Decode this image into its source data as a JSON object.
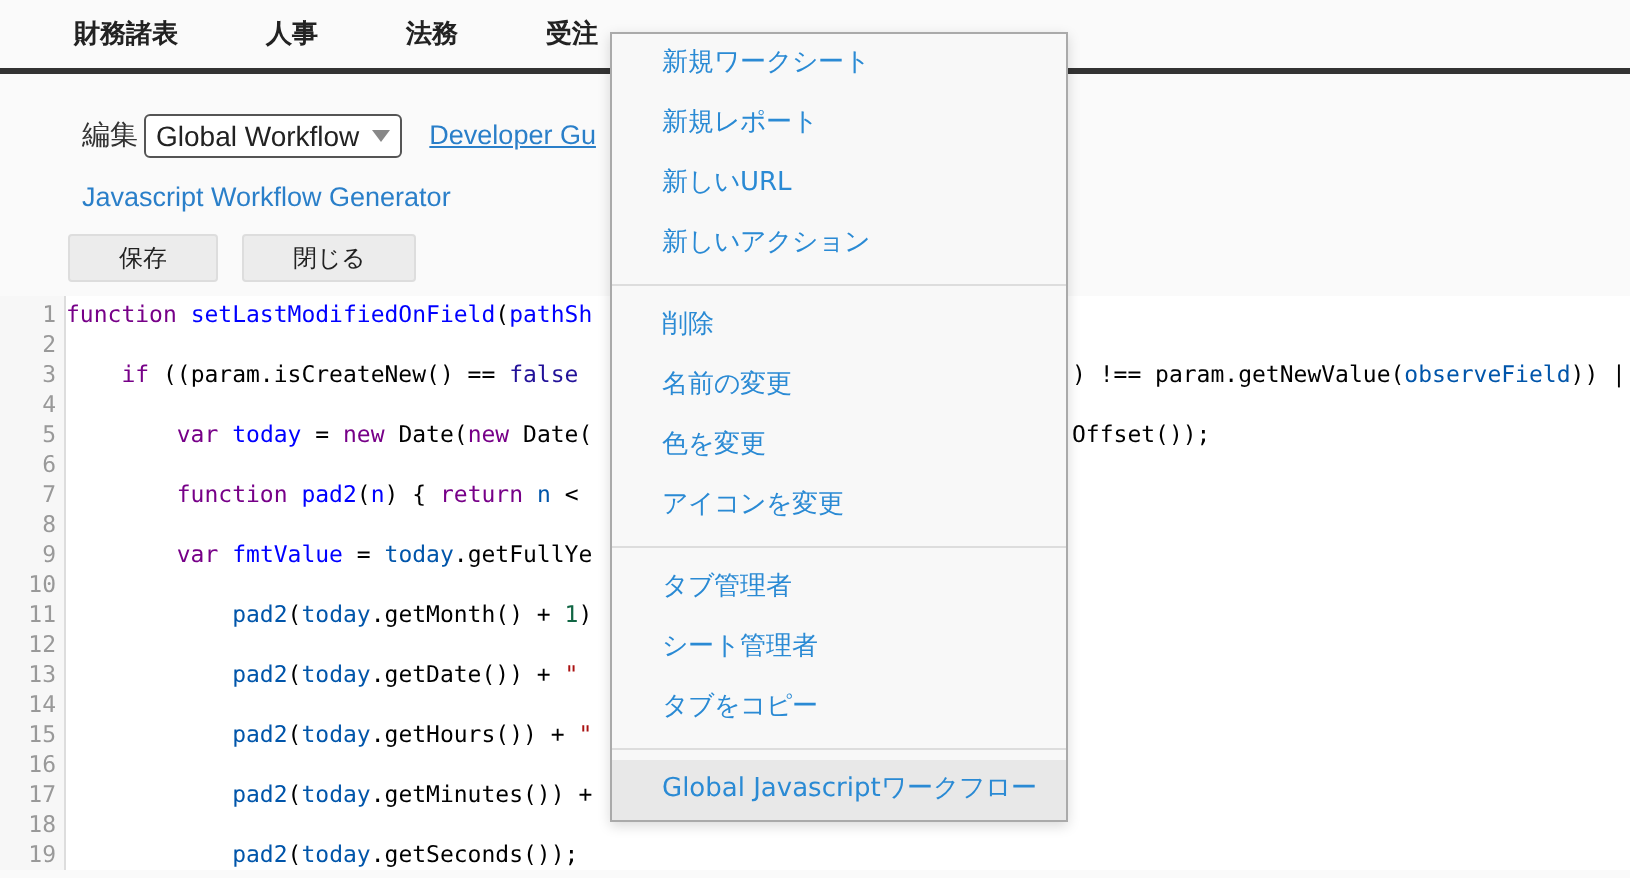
{
  "nav": {
    "tabs": [
      {
        "label": "財務諸表"
      },
      {
        "label": "人事"
      },
      {
        "label": "法務"
      },
      {
        "label": "受注"
      }
    ]
  },
  "editor": {
    "label": "編集",
    "select": {
      "value": "Global Workflow"
    },
    "guide_link": "Developer Gu",
    "generator_link": "Javascript Workflow Generator"
  },
  "buttons": [
    "保存",
    "閉じる"
  ],
  "code": {
    "lines": [
      {
        "number": "1",
        "left": [
          {
            "t": "function",
            "kind": "keyword"
          },
          {
            "t": " setLastModifiedOnField",
            "kind": "def"
          },
          {
            "t": "(",
            "kind": "plain"
          },
          {
            "t": "pathSh",
            "kind": "def"
          }
        ]
      },
      {
        "number": "2"
      },
      {
        "number": "3",
        "left": [
          {
            "t": "    if",
            "kind": "keyword"
          },
          {
            "t": " ((param.isCreateNew() == ",
            "kind": "plain"
          },
          {
            "t": "false",
            "kind": "atom"
          }
        ],
        "right": [
          {
            "t": ") !== param.getNewValue(",
            "kind": "plain"
          },
          {
            "t": "observeField",
            "kind": "variable"
          },
          {
            "t": ")) |",
            "kind": "plain"
          }
        ]
      },
      {
        "number": "4"
      },
      {
        "number": "5",
        "left": [
          {
            "t": "        var",
            "kind": "keyword"
          },
          {
            "t": " today",
            "kind": "def"
          },
          {
            "t": " = ",
            "kind": "plain"
          },
          {
            "t": "new",
            "kind": "keyword"
          },
          {
            "t": " Date(",
            "kind": "plain"
          },
          {
            "t": "new",
            "kind": "keyword"
          },
          {
            "t": " Date(",
            "kind": "plain"
          }
        ],
        "right": [
          {
            "t": "Offset());",
            "kind": "plain"
          }
        ]
      },
      {
        "number": "6"
      },
      {
        "number": "7",
        "left": [
          {
            "t": "        function",
            "kind": "keyword"
          },
          {
            "t": " pad2",
            "kind": "def"
          },
          {
            "t": "(",
            "kind": "plain"
          },
          {
            "t": "n",
            "kind": "def"
          },
          {
            "t": ") { ",
            "kind": "plain"
          },
          {
            "t": "return",
            "kind": "keyword"
          },
          {
            "t": " n",
            "kind": "variable"
          },
          {
            "t": " <",
            "kind": "plain"
          }
        ]
      },
      {
        "number": "8"
      },
      {
        "number": "9",
        "left": [
          {
            "t": "        var",
            "kind": "keyword"
          },
          {
            "t": " fmtValue",
            "kind": "def"
          },
          {
            "t": " = ",
            "kind": "plain"
          },
          {
            "t": "today",
            "kind": "variable"
          },
          {
            "t": ".getFullYe",
            "kind": "plain"
          }
        ]
      },
      {
        "number": "10"
      },
      {
        "number": "11",
        "left": [
          {
            "t": "            pad2",
            "kind": "variable"
          },
          {
            "t": "(",
            "kind": "plain"
          },
          {
            "t": "today",
            "kind": "variable"
          },
          {
            "t": ".getMonth() + ",
            "kind": "plain"
          },
          {
            "t": "1",
            "kind": "number"
          },
          {
            "t": ")",
            "kind": "plain"
          }
        ]
      },
      {
        "number": "12"
      },
      {
        "number": "13",
        "left": [
          {
            "t": "            pad2",
            "kind": "variable"
          },
          {
            "t": "(",
            "kind": "plain"
          },
          {
            "t": "today",
            "kind": "variable"
          },
          {
            "t": ".getDate()) + ",
            "kind": "plain"
          },
          {
            "t": "\"",
            "kind": "string"
          }
        ]
      },
      {
        "number": "14"
      },
      {
        "number": "15",
        "left": [
          {
            "t": "            pad2",
            "kind": "variable"
          },
          {
            "t": "(",
            "kind": "plain"
          },
          {
            "t": "today",
            "kind": "variable"
          },
          {
            "t": ".getHours()) + ",
            "kind": "plain"
          },
          {
            "t": "\"",
            "kind": "string"
          }
        ]
      },
      {
        "number": "16"
      },
      {
        "number": "17",
        "left": [
          {
            "t": "            pad2",
            "kind": "variable"
          },
          {
            "t": "(",
            "kind": "plain"
          },
          {
            "t": "today",
            "kind": "variable"
          },
          {
            "t": ".getMinutes()) +",
            "kind": "plain"
          }
        ]
      },
      {
        "number": "18"
      },
      {
        "number": "19",
        "left": [
          {
            "t": "            pad2",
            "kind": "variable"
          },
          {
            "t": "(",
            "kind": "plain"
          },
          {
            "t": "today",
            "kind": "variable"
          },
          {
            "t": ".getSeconds());",
            "kind": "plain"
          }
        ]
      }
    ]
  },
  "menu": {
    "groups": [
      [
        {
          "label": "新規ワークシート",
          "selected": false
        },
        {
          "label": "新規レポート",
          "selected": false
        },
        {
          "label": "新しいURL",
          "selected": false
        },
        {
          "label": "新しいアクション",
          "selected": false
        }
      ],
      [
        {
          "label": "削除",
          "selected": false
        },
        {
          "label": "名前の変更",
          "selected": false
        },
        {
          "label": "色を変更",
          "selected": false
        },
        {
          "label": "アイコンを変更",
          "selected": false
        }
      ],
      [
        {
          "label": "タブ管理者",
          "selected": false
        },
        {
          "label": "シート管理者",
          "selected": false
        },
        {
          "label": "タブをコピー",
          "selected": false
        }
      ],
      [
        {
          "label": "Global Javascriptワークフロー",
          "selected": true
        }
      ]
    ]
  }
}
